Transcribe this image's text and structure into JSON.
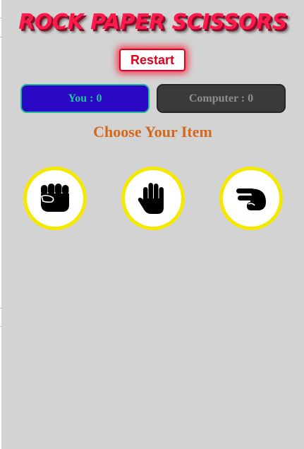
{
  "game": {
    "title": "ROCK PAPER SCISSORS",
    "restart_label": "Restart",
    "choose_label": "Choose Your Item",
    "title_color": "#ff1a4b",
    "accent_color": "#e0001b"
  },
  "scores": {
    "you": "You : 0",
    "computer": "Computer : 0",
    "you_bg": "#2a08c4",
    "computer_bg": "#3a3a3a"
  },
  "items": [
    {
      "name": "rock",
      "icon": "fist-icon"
    },
    {
      "name": "paper",
      "icon": "open-hand-icon"
    },
    {
      "name": "scissors",
      "icon": "peace-hand-icon"
    }
  ]
}
